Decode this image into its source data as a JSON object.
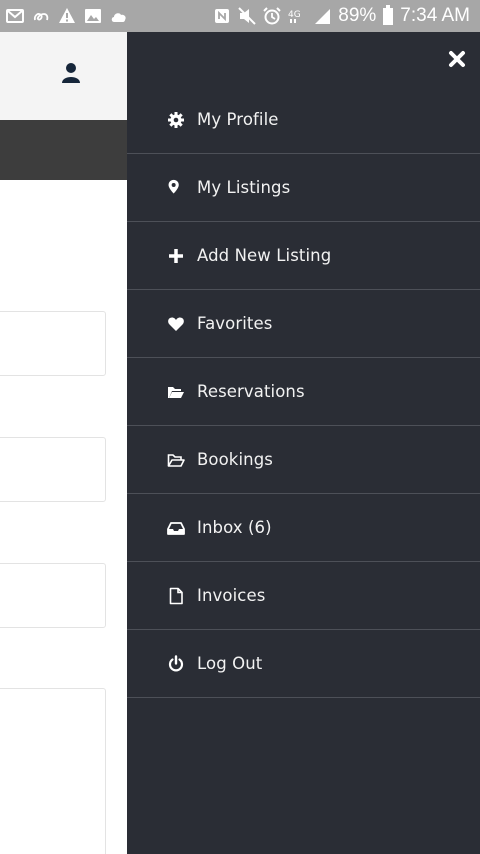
{
  "status_bar": {
    "battery": "89%",
    "time": "7:34 AM",
    "left_icons": [
      "mail-icon",
      "link-icon",
      "warning-icon",
      "image-icon",
      "cloud-icon"
    ],
    "right_icons": [
      "nfc-icon",
      "mute-icon",
      "alarm-icon",
      "lte-icon",
      "signal-icon",
      "battery-icon"
    ]
  },
  "drawer": {
    "close_icon": "close-icon",
    "items": [
      {
        "label": "My Profile",
        "icon": "gear-icon"
      },
      {
        "label": "My Listings",
        "icon": "map-pin-icon"
      },
      {
        "label": "Add New Listing",
        "icon": "plus-icon"
      },
      {
        "label": "Favorites",
        "icon": "heart-icon"
      },
      {
        "label": "Reservations",
        "icon": "folder-open-icon"
      },
      {
        "label": "Bookings",
        "icon": "folder-outline-icon"
      },
      {
        "label": "Inbox (6)",
        "icon": "inbox-icon"
      },
      {
        "label": "Invoices",
        "icon": "document-icon"
      },
      {
        "label": "Log Out",
        "icon": "power-icon"
      }
    ]
  },
  "colors": {
    "drawer_bg": "#2a2d35",
    "divider": "#4d5058",
    "status_bar": "#a7a7a7",
    "header_bg": "#f4f4f4",
    "dark_band": "#3d3d3d",
    "user_icon": "#16263a"
  }
}
